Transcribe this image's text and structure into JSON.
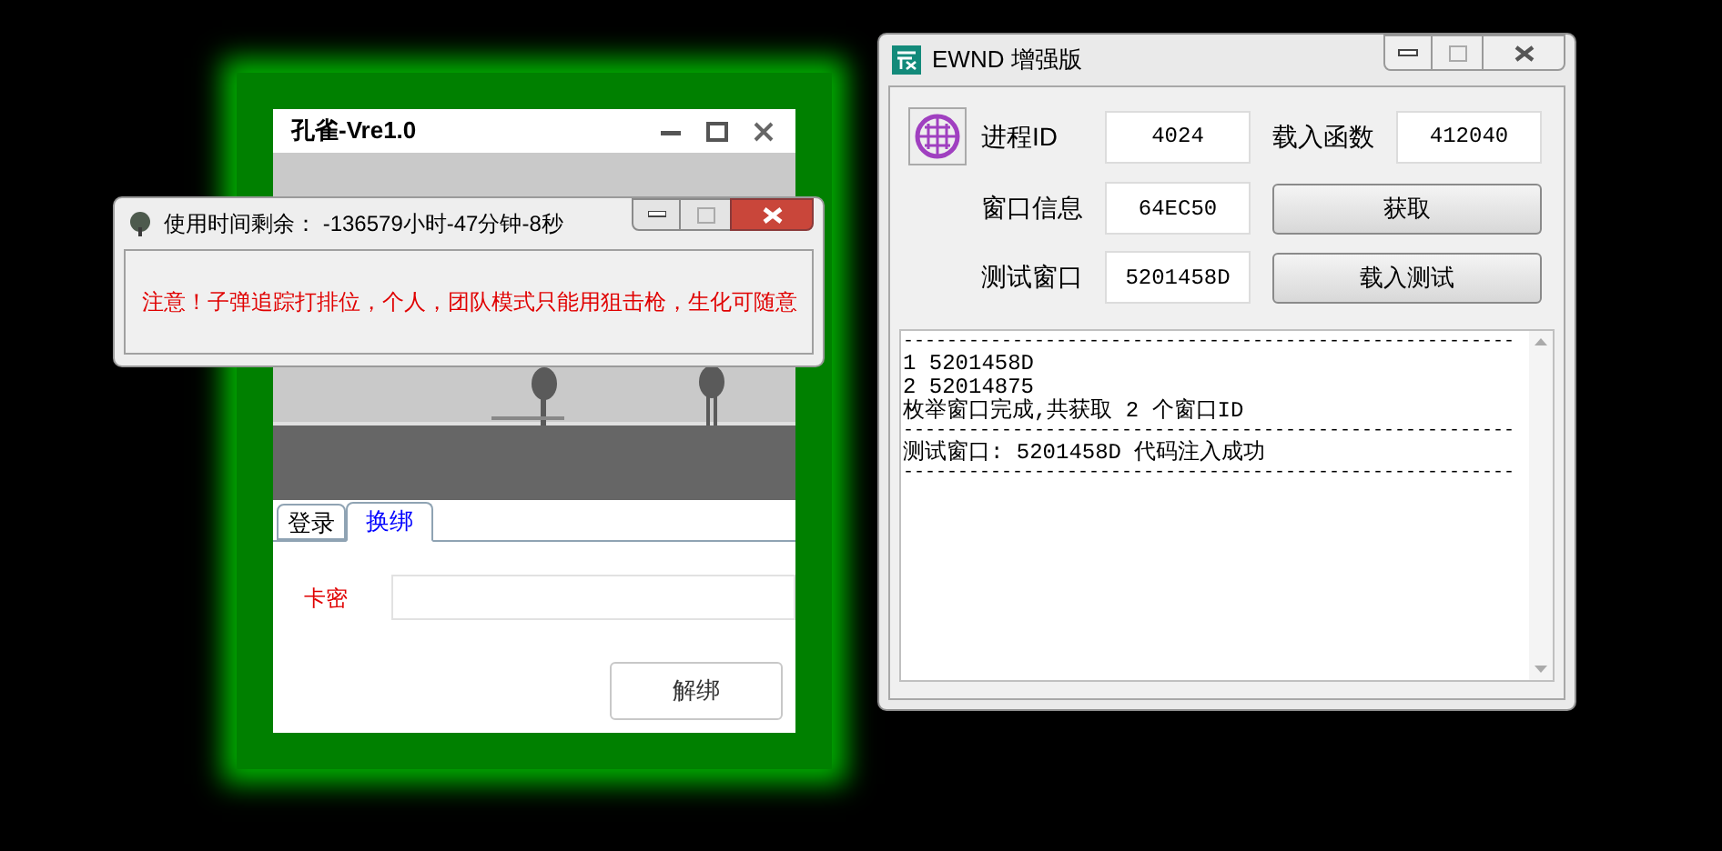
{
  "main_window": {
    "title": "孔雀-Vre1.0",
    "tabs": [
      {
        "label": "登录",
        "selected": false
      },
      {
        "label": "换绑",
        "selected": true
      }
    ],
    "card_label": "卡密",
    "unbind_button": "解绑"
  },
  "popup": {
    "title": "使用时间剩余： -136579小时-47分钟-8秒",
    "notice": "注意！子弹追踪打排位，个人，团队模式只能用狙击枪，生化可随意"
  },
  "tool_window": {
    "title": "EWND 增强版",
    "fields": [
      {
        "label": "进程ID",
        "value": "4024"
      },
      {
        "label": "载入函数",
        "value": "412040"
      },
      {
        "label": "窗口信息",
        "value": "64EC50"
      },
      {
        "label": "测试窗口",
        "value": "5201458D"
      }
    ],
    "buttons": [
      "获取",
      "载入测试"
    ],
    "log": [
      {
        "kind": "rule",
        "text": "--------------------------------------------------------"
      },
      {
        "kind": "line",
        "text": "1 5201458D"
      },
      {
        "kind": "line",
        "text": "2 52014875"
      },
      {
        "kind": "line",
        "text": "枚举窗口完成,共获取 2 个窗口ID"
      },
      {
        "kind": "rule",
        "text": "--------------------------------------------------------"
      },
      {
        "kind": "line",
        "text": "测试窗口: 5201458D 代码注入成功"
      },
      {
        "kind": "rule",
        "text": "--------------------------------------------------------"
      }
    ]
  }
}
